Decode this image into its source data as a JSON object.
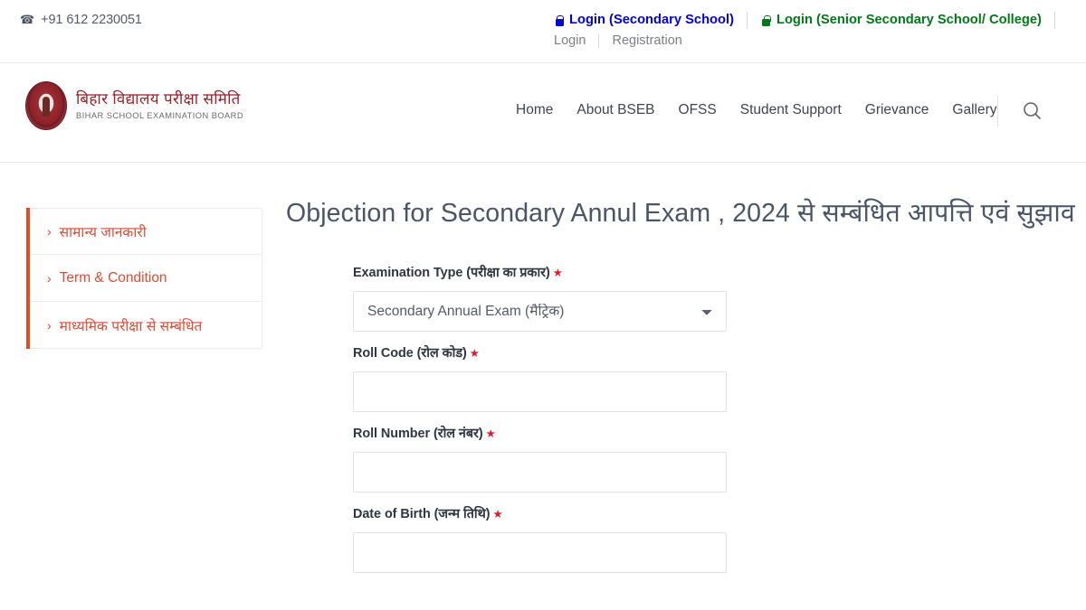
{
  "topbar": {
    "phone_icon": "phone-icon",
    "phone": "+91 612 2230051",
    "login_secondary": {
      "label": "Login (Secondary School)",
      "icon": "lock-icon",
      "color": "#0000e0"
    },
    "login_senior": {
      "label": "Login (Senior Secondary School/ College)",
      "icon": "lock-icon",
      "color": "#007a16"
    },
    "sublinks": {
      "login": "Login",
      "registration": "Registration"
    }
  },
  "header": {
    "logo": {
      "icon": "bseb-seal-logo",
      "title_hi": "बिहार विद्यालय परीक्षा समिति",
      "title_en": "BIHAR SCHOOL EXAMINATION BOARD"
    },
    "nav": [
      {
        "label": "Home"
      },
      {
        "label": "About BSEB"
      },
      {
        "label": "OFSS"
      },
      {
        "label": "Student Support"
      },
      {
        "label": "Grievance"
      },
      {
        "label": "Gallery"
      }
    ],
    "search_icon": "search-icon"
  },
  "page": {
    "title": "Objection for Secondary Annul Exam , 2024 से सम्बंधित आपत्ति एवं सुझाव",
    "accent_color": "#e8491d"
  },
  "sidebar": {
    "items": [
      {
        "label": "सामान्य जानकारी",
        "chevron": "›"
      },
      {
        "label": "Term & Condition",
        "chevron": "›"
      },
      {
        "label": "माध्यमिक परीक्षा से सम्बंधित",
        "chevron": "›"
      }
    ]
  },
  "form": {
    "required_marker": "★",
    "fields": [
      {
        "label": "Examination Type (परीक्षा का प्रकार)",
        "type": "select",
        "value": "Secondary Annual Exam (मैट्रिक)",
        "options": [
          "Secondary Annual Exam (मैट्रिक)"
        ],
        "required": true
      },
      {
        "label": "Roll Code (रोल कोड)",
        "type": "text",
        "value": "",
        "placeholder": "",
        "required": true
      },
      {
        "label": "Roll Number (रोल नंबर)",
        "type": "text",
        "value": "",
        "placeholder": "",
        "required": true
      },
      {
        "label": "Date of Birth (जन्म तिथि)",
        "type": "text",
        "value": "",
        "placeholder": "",
        "required": true
      }
    ]
  }
}
